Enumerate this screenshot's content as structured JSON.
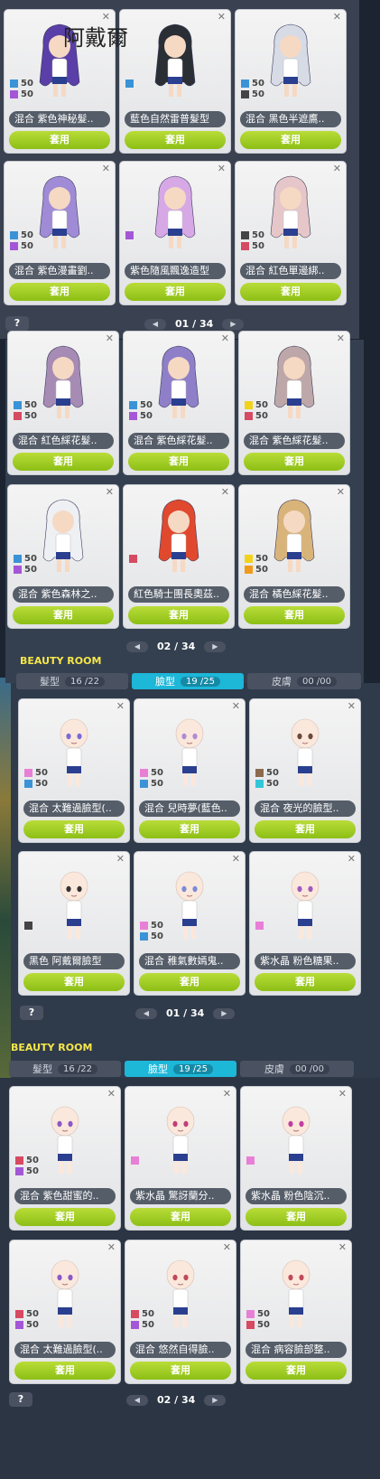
{
  "overlay_title": "阿戴爾",
  "use_label": "套用",
  "help_label": "?",
  "colors": {
    "purple": "#a357d6",
    "blue": "#3a93d6",
    "black": "#444444",
    "red": "#d64a62",
    "yellow": "#f2d21c",
    "orange": "#f29a1c",
    "pink": "#e87fd6",
    "brown": "#8b6a4e",
    "cyan": "#33c6d8"
  },
  "panels": [
    {
      "page": "01 / 34",
      "cards": [
        {
          "name": "混合  紫色神秘髮..",
          "sw": [
            [
              "blue",
              "50"
            ],
            [
              "purple",
              "50"
            ]
          ],
          "hair": "#5a3fa8"
        },
        {
          "name": "藍色自然雷普髮型",
          "sw": [
            [
              "blue",
              ""
            ]
          ],
          "hair": "#2a2f36"
        },
        {
          "name": "混合  黑色半遮鷹..",
          "sw": [
            [
              "blue",
              "50"
            ],
            [
              "black",
              "50"
            ]
          ],
          "hair": "#d6dbe6"
        },
        {
          "name": "混合  紫色漫畫劉..",
          "sw": [
            [
              "blue",
              "50"
            ],
            [
              "purple",
              "50"
            ]
          ],
          "hair": "#9f8bd6"
        },
        {
          "name": "紫色隨風飄逸造型",
          "sw": [
            [
              "purple",
              ""
            ]
          ],
          "hair": "#d7a8e6"
        },
        {
          "name": "混合  紅色單邊綁..",
          "sw": [
            [
              "black",
              "50"
            ],
            [
              "red",
              "50"
            ]
          ],
          "hair": "#e6c7c9"
        }
      ]
    },
    {
      "page": "02 / 34",
      "cards": [
        {
          "name": "混合  紅色綵花髮..",
          "sw": [
            [
              "blue",
              "50"
            ],
            [
              "red",
              "50"
            ]
          ],
          "hair": "#a68bb5"
        },
        {
          "name": "混合  紫色綵花髮..",
          "sw": [
            [
              "blue",
              "50"
            ],
            [
              "purple",
              "50"
            ]
          ],
          "hair": "#8f7fc8"
        },
        {
          "name": "混合  紫色綵花髮..",
          "sw": [
            [
              "yellow",
              "50"
            ],
            [
              "red",
              "50"
            ]
          ],
          "hair": "#bda7a8"
        },
        {
          "name": "混合  紫色森林之..",
          "sw": [
            [
              "blue",
              "50"
            ],
            [
              "purple",
              "50"
            ]
          ],
          "hair": "#eef0f4"
        },
        {
          "name": "紅色騎士團長奧茲..",
          "sw": [
            [
              "red",
              ""
            ]
          ],
          "hair": "#e0492e"
        },
        {
          "name": "混合  橘色綵花髮..",
          "sw": [
            [
              "yellow",
              "50"
            ],
            [
              "orange",
              "50"
            ]
          ],
          "hair": "#d9b47a"
        }
      ]
    },
    {
      "title": "BEAUTY ROOM",
      "tabs": [
        {
          "label": "髮型",
          "count": "16 /22",
          "active": false
        },
        {
          "label": "臉型",
          "count": "19 /25",
          "active": true
        },
        {
          "label": "皮膚",
          "count": "00 /00",
          "active": false
        }
      ],
      "page": "01 / 34",
      "cards": [
        {
          "name": "混合  太難過臉型(..",
          "sw": [
            [
              "pink",
              "50"
            ],
            [
              "blue",
              "50"
            ]
          ],
          "eye": "#7b6ad6"
        },
        {
          "name": "混合  兒時夢(藍色..",
          "sw": [
            [
              "pink",
              "50"
            ],
            [
              "blue",
              "50"
            ]
          ],
          "eye": "#b08ad6"
        },
        {
          "name": "混合  夜光的臉型..",
          "sw": [
            [
              "brown",
              "50"
            ],
            [
              "cyan",
              "50"
            ]
          ],
          "eye": "#6a4a3a"
        },
        {
          "name": "黑色  阿戴爾臉型",
          "sw": [
            [
              "black",
              ""
            ]
          ],
          "eye": "#333333"
        },
        {
          "name": "混合  稚氣數嫣鬼..",
          "sw": [
            [
              "pink",
              "50"
            ],
            [
              "blue",
              "50"
            ]
          ],
          "eye": "#7a8ad6"
        },
        {
          "name": "紫水晶  粉色糖果..",
          "sw": [
            [
              "pink",
              ""
            ]
          ],
          "eye": "#a05ac0"
        }
      ]
    },
    {
      "title": "BEAUTY ROOM",
      "tabs": [
        {
          "label": "髮型",
          "count": "16 /22",
          "active": false
        },
        {
          "label": "臉型",
          "count": "19 /25",
          "active": true
        },
        {
          "label": "皮膚",
          "count": "00 /00",
          "active": false
        }
      ],
      "page": "02 / 34",
      "cards": [
        {
          "name": "混合  紫色甜蜜的..",
          "sw": [
            [
              "red",
              "50"
            ],
            [
              "purple",
              "50"
            ]
          ],
          "eye": "#8a5ac8"
        },
        {
          "name": "紫水晶  驚訝蘭分..",
          "sw": [
            [
              "pink",
              ""
            ]
          ],
          "eye": "#c0407a"
        },
        {
          "name": "紫水晶  粉色陰沉..",
          "sw": [
            [
              "pink",
              ""
            ]
          ],
          "eye": "#c040a0"
        },
        {
          "name": "混合  太難過臉型(..",
          "sw": [
            [
              "red",
              "50"
            ],
            [
              "purple",
              "50"
            ]
          ],
          "eye": "#8a5ac8"
        },
        {
          "name": "混合  悠然自得臉..",
          "sw": [
            [
              "red",
              "50"
            ],
            [
              "purple",
              "50"
            ]
          ],
          "eye": "#c04a5a"
        },
        {
          "name": "混合  病容臉部整..",
          "sw": [
            [
              "pink",
              "50"
            ],
            [
              "red",
              "50"
            ]
          ],
          "eye": "#c04a5a"
        }
      ]
    }
  ]
}
